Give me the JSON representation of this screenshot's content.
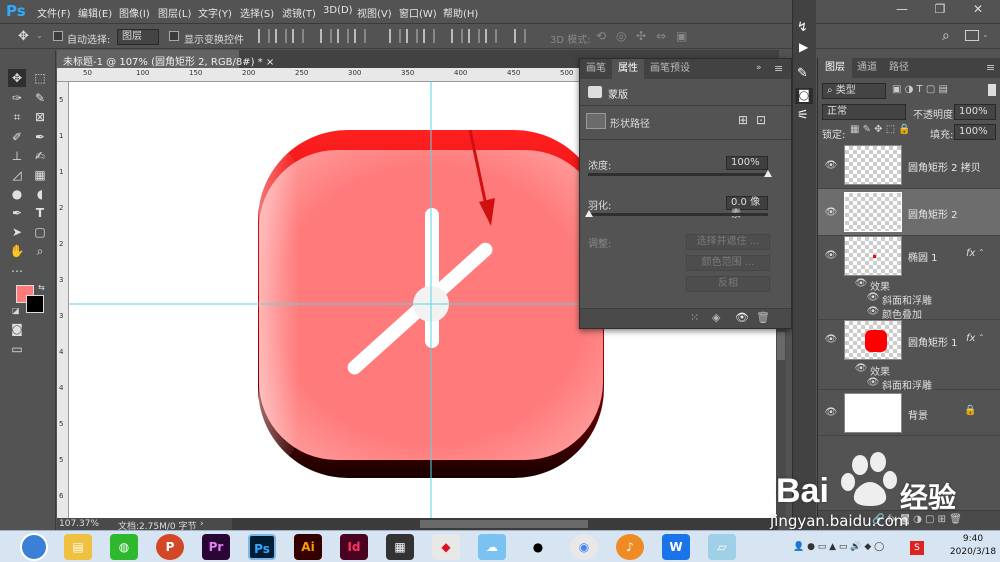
{
  "app": {
    "logo": "Ps"
  },
  "menu": [
    "文件(F)",
    "编辑(E)",
    "图像(I)",
    "图层(L)",
    "文字(Y)",
    "选择(S)",
    "滤镜(T)",
    "3D(D)",
    "视图(V)",
    "窗口(W)",
    "帮助(H)"
  ],
  "options": {
    "auto_select_label": "自动选择:",
    "auto_select_value": "图层",
    "show_transform_label": "显示变换控件",
    "mode_3d_label": "3D 模式:"
  },
  "document": {
    "tab_title": "未标题-1 @ 107% (圆角矩形 2, RGB/8#) *",
    "zoom": "107.37%",
    "doc_info": "文档:2.75M/0 字节"
  },
  "ruler": {
    "h_ticks": [
      "50",
      "100",
      "150",
      "200",
      "250",
      "300",
      "350",
      "400",
      "450",
      "500",
      "550",
      "600",
      "650"
    ],
    "v_ticks": [
      "5",
      "1",
      "1",
      "2",
      "2",
      "3",
      "3",
      "4",
      "4",
      "5",
      "5",
      "6"
    ]
  },
  "properties": {
    "tabs": [
      "画笔",
      "属性",
      "画笔预设"
    ],
    "active_tab": "属性",
    "section": "蒙版",
    "shape_path_label": "形状路径",
    "density_label": "浓度:",
    "density_value": "100%",
    "density": 1.0,
    "feather_label": "羽化:",
    "feather_value": "0.0 像素",
    "adjust_label": "调整:",
    "btn_select_mask": "选择并遮住 ...",
    "btn_color_range": "颜色范围 ...",
    "btn_invert": "反相"
  },
  "layers": {
    "tabs": [
      "图层",
      "通道",
      "路径"
    ],
    "filter_label": "类型",
    "blend_mode": "正常",
    "opacity_label": "不透明度:",
    "opacity_value": "100%",
    "lock_label": "锁定:",
    "fill_label": "填充:",
    "fill_value": "100%",
    "items": [
      {
        "name": "圆角矩形 2 拷贝",
        "fx": false
      },
      {
        "name": "圆角矩形 2",
        "fx": false,
        "selected": true
      },
      {
        "name": "椭圆 1",
        "fx": true,
        "effects_label": "效果",
        "effects": [
          "斜面和浮雕",
          "颜色叠加"
        ]
      },
      {
        "name": "圆角矩形 1",
        "fx": true,
        "effects_label": "效果",
        "effects": [
          "斜面和浮雕"
        ]
      },
      {
        "name": "背景",
        "fx": false,
        "locked": true
      }
    ],
    "fx_label": "fx"
  },
  "taskbar": {
    "apps": [
      "Pr",
      "Ps",
      "Ai",
      "Id"
    ],
    "time": "9:40",
    "date": "2020/3/18",
    "ime": "S"
  },
  "watermark": {
    "brand": "Bai",
    "brand2": "经验",
    "url": "jingyan.baidu.com"
  },
  "colors": {
    "icon_red": "#ff7b7b",
    "guide": "#5ad6e6",
    "ps_blue": "#31a8ff"
  }
}
